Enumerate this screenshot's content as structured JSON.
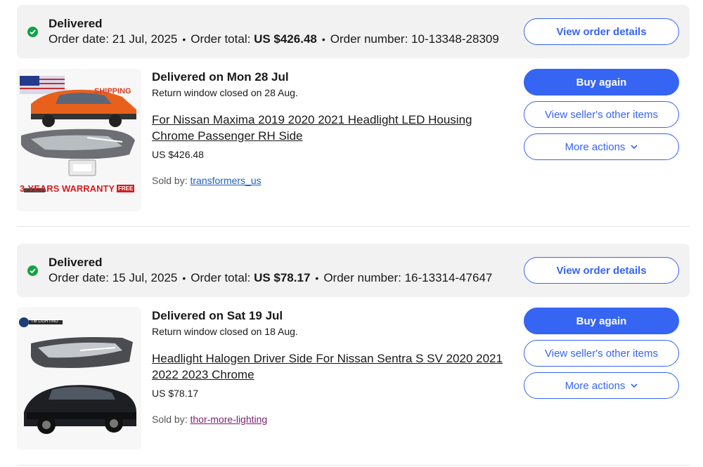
{
  "orders": [
    {
      "status": "Delivered",
      "order_date_label": "Order date:",
      "order_date": "21 Jul, 2025",
      "order_total_label": "Order total:",
      "order_total": "US $426.48",
      "order_number_label": "Order number:",
      "order_number": "10-13348-28309",
      "view_order_details": "View order details",
      "delivered_on": "Delivered on Mon 28 Jul",
      "return_window": "Return window closed on 28 Aug.",
      "item_title": "For Nissan Maxima 2019 2020 2021 Headlight LED Housing Chrome Passenger RH Side",
      "price": "US $426.48",
      "sold_by_label": "Sold by:",
      "seller": "transformers_us",
      "seller_color": "#1f5fbf",
      "buy_again": "Buy again",
      "view_seller_items": "View seller's other items",
      "more_actions": "More actions",
      "thumb_text_banner": "3-YEARS WARRANTY",
      "thumb_text_shipping": "SHIPPING",
      "thumb_text_free": "FREE"
    },
    {
      "status": "Delivered",
      "order_date_label": "Order date:",
      "order_date": "15 Jul, 2025",
      "order_total_label": "Order total:",
      "order_total": "US $78.17",
      "order_number_label": "Order number:",
      "order_number": "16-13314-47647",
      "view_order_details": "View order details",
      "delivered_on": "Delivered on Sat 19 Jul",
      "return_window": "Return window closed on 18 Aug.",
      "item_title": "Headlight Halogen Driver Side For Nissan Sentra S SV 2020 2021 2022 2023 Chrome",
      "price": "US $78.17",
      "sold_by_label": "Sold by:",
      "seller": "thor-more-lighting",
      "seller_color": "#7a1f6e",
      "buy_again": "Buy again",
      "view_seller_items": "View seller's other items",
      "more_actions": "More actions",
      "thumb_text_logo": "TM LIGHTING"
    }
  ],
  "colors": {
    "accent": "#3665f3",
    "success": "#12a244",
    "header_bg": "#f2f2f2"
  },
  "icons": {
    "status": "check-circle-icon",
    "more": "chevron-down-icon"
  }
}
